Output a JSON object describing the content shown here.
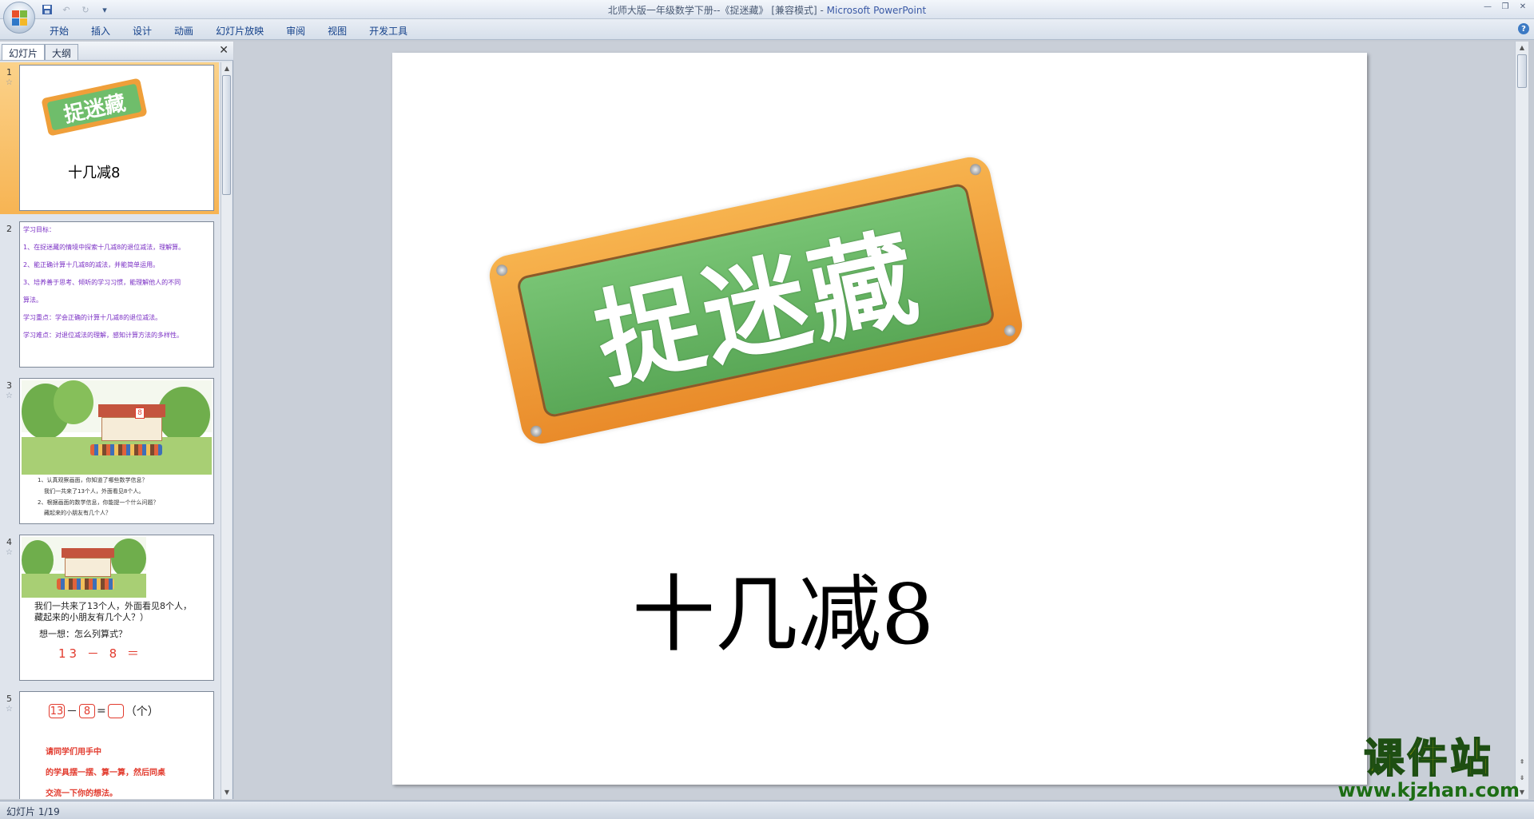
{
  "window": {
    "title_doc": "北师大版一年级数学下册--《捉迷藏》  [兼容模式]  - ",
    "title_app": "Microsoft PowerPoint"
  },
  "qat": [
    "save-icon",
    "undo-icon",
    "redo-icon",
    "customize-icon"
  ],
  "ribbon": {
    "tabs": [
      "开始",
      "插入",
      "设计",
      "动画",
      "幻灯片放映",
      "审阅",
      "视图",
      "开发工具"
    ],
    "help": "?"
  },
  "left_pane": {
    "tab_slides": "幻灯片",
    "tab_outline": "大纲",
    "close": "✕"
  },
  "thumbnails": {
    "s1": {
      "num": "1",
      "sign": "捉迷藏",
      "subtitle": "十几减8"
    },
    "s2": {
      "num": "2",
      "lines": [
        "学习目标：",
        "1、在捉迷藏的情境中探索十几减8的退位减法，理解算。",
        "2、能正确计算十几减8的减法，并能简单运用。",
        "3、培养善于思考、倾听的学习习惯，能理解他人的不同",
        "算法。",
        "学习重点：学会正确的计算十几减8的退位减法。",
        "学习难点：对退位减法的理解，感知计算方法的多样性。"
      ]
    },
    "s3": {
      "num": "3",
      "badge": "8",
      "lines": [
        "1、认真观察画面，你知道了哪些数学信息？",
        "我们一共来了13个人，外面看见8个人。",
        "2、根据画面的数学信息，你能提一个什么问题？",
        "藏起来的小朋友有几个人？"
      ]
    },
    "s4": {
      "num": "4",
      "line1": "我们一共来了13个人，外面看见8个人，",
      "line2": "藏起来的小朋友有几个人？）",
      "line3": "想一想：怎么列算式？",
      "formula": "13 － 8 ＝"
    },
    "s5": {
      "num": "5",
      "a": "13",
      "op": "－",
      "b": "8",
      "eq": "=",
      "unit": "（个）",
      "lines": [
        "请同学们用手中",
        "的学具摆一摆、算一算，然后同桌",
        "交流一下你的想法。"
      ]
    }
  },
  "slide": {
    "sign_text": "捉迷藏",
    "subtitle": "十几减8"
  },
  "watermark": {
    "title": "课件站",
    "url": "www.kjzhan.com"
  },
  "status": {
    "slide_counter": "幻灯片 1/19"
  }
}
